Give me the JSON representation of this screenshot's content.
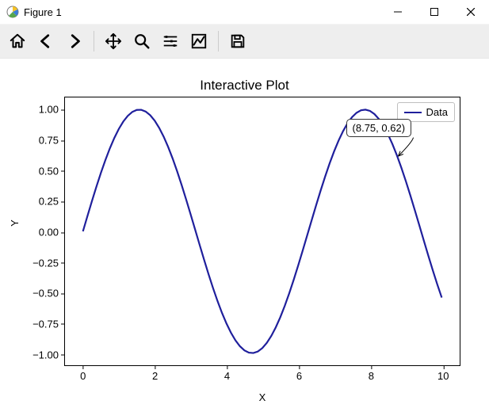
{
  "window": {
    "title": "Figure 1"
  },
  "toolbar": {
    "items": [
      {
        "name": "home-icon"
      },
      {
        "name": "back-icon"
      },
      {
        "name": "forward-icon"
      },
      {
        "sep": true
      },
      {
        "name": "pan-icon"
      },
      {
        "name": "zoom-icon"
      },
      {
        "name": "subplots-icon"
      },
      {
        "name": "axes-edit-icon"
      },
      {
        "sep": true
      },
      {
        "name": "save-icon"
      }
    ]
  },
  "chart_data": {
    "type": "line",
    "title": "Interactive Plot",
    "xlabel": "X",
    "ylabel": "Y",
    "xlim": [
      -0.5,
      10.5
    ],
    "ylim": [
      -1.1,
      1.1
    ],
    "xticks": [
      0,
      2,
      4,
      6,
      8,
      10
    ],
    "yticks": [
      -1.0,
      -0.75,
      -0.5,
      -0.25,
      0.0,
      0.25,
      0.5,
      0.75,
      1.0
    ],
    "series": [
      {
        "name": "Data",
        "color": "#1f1f9c",
        "function": "sin(x)",
        "x_range": [
          0,
          10
        ],
        "sample_points": 80
      }
    ],
    "legend": {
      "position": "upper-right",
      "entries": [
        "Data"
      ]
    },
    "annotation": {
      "text": "(8.75, 0.62)",
      "xy": [
        8.75,
        0.62
      ],
      "xytext": [
        7.3,
        0.85
      ]
    }
  },
  "colors": {
    "line": "#1f1f9c",
    "toolbar_bg": "#eeeeee"
  }
}
